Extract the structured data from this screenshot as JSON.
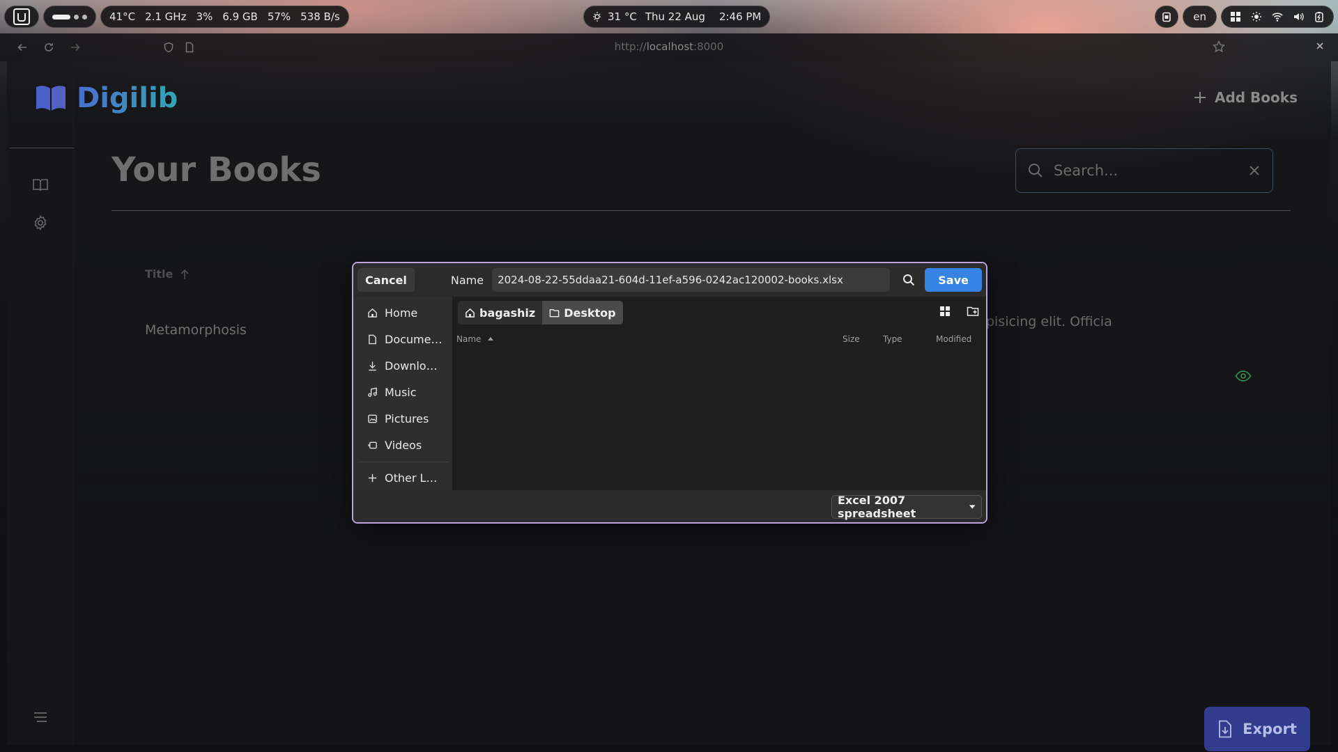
{
  "topbar": {
    "stats": {
      "temp": "41°C",
      "cpu_freq": "2.1 GHz",
      "cpu_usage": "3%",
      "memory": "6.9 GB",
      "memory_pct": "57%",
      "network": "538 B/s"
    },
    "weather": "31 °C",
    "date": "Thu 22 Aug",
    "time": "2:46 PM",
    "language": "en"
  },
  "browser": {
    "url_prefix": "http://",
    "url_host": "localhost",
    "url_port": ":8000"
  },
  "app": {
    "brand": "Digilib",
    "add_books": "Add Books",
    "page_title": "Your Books",
    "search_placeholder": "Search...",
    "table": {
      "col_title": "Title",
      "rows": [
        {
          "title": "Metamorphosis",
          "description": "pisicing elit. Officia"
        }
      ]
    },
    "export": "Export"
  },
  "dialog": {
    "cancel": "Cancel",
    "name_label": "Name",
    "file_name": "2024-08-22-55ddaa21-604d-11ef-a596-0242ac120002-books.xlsx",
    "save": "Save",
    "places": [
      {
        "label": "Home",
        "icon": "home-icon"
      },
      {
        "label": "Docume…",
        "icon": "document-icon"
      },
      {
        "label": "Downlo…",
        "icon": "download-icon"
      },
      {
        "label": "Music",
        "icon": "music-icon"
      },
      {
        "label": "Pictures",
        "icon": "image-icon"
      },
      {
        "label": "Videos",
        "icon": "video-icon"
      }
    ],
    "other_locations": "Other L…",
    "path": [
      "bagashiz",
      "Desktop"
    ],
    "columns": {
      "name": "Name",
      "size": "Size",
      "type": "Type",
      "modified": "Modified"
    },
    "file_type": "Excel 2007 spreadsheet"
  },
  "colors": {
    "brand_gradient_start": "#4a6fcf",
    "brand_gradient_end": "#33a5b0",
    "save_button": "#3584e4",
    "dialog_border": "#b9a4de",
    "export_button": "#323c8d",
    "eye_icon": "#2f8a4a"
  }
}
